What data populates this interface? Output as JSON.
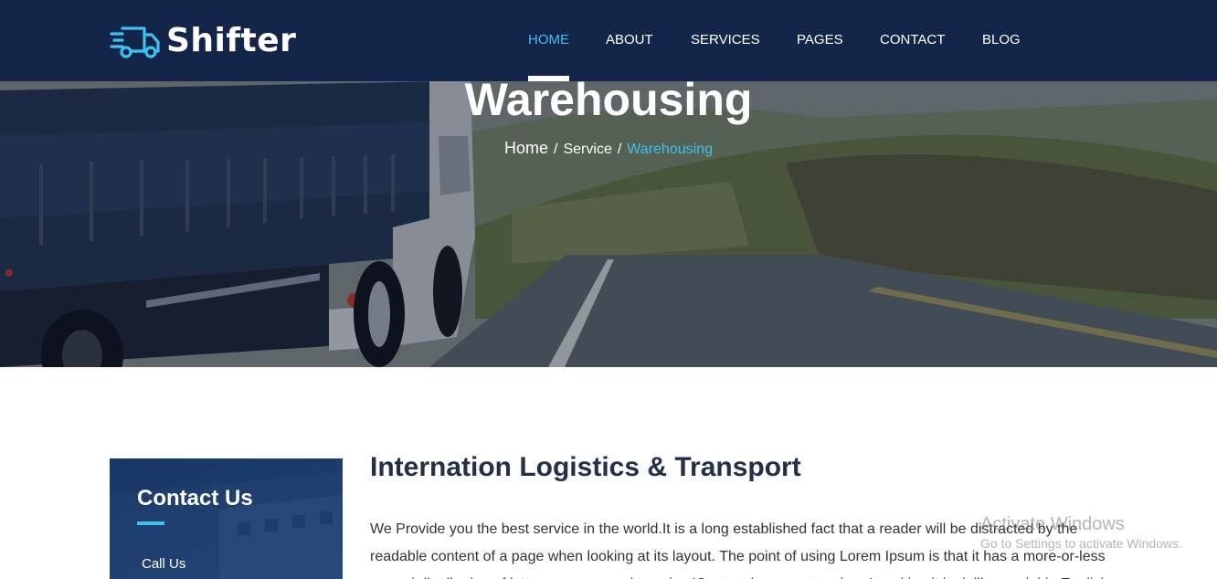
{
  "brand": {
    "name": "Shifter",
    "logo_icon": "delivery-truck-icon",
    "accent_color": "#3ec1f0",
    "header_color": "#13264a"
  },
  "nav": {
    "items": [
      {
        "label": "HOME",
        "active": true
      },
      {
        "label": "ABOUT",
        "active": false
      },
      {
        "label": "SERVICES",
        "active": false
      },
      {
        "label": "PAGES",
        "active": false
      },
      {
        "label": "CONTACT",
        "active": false
      },
      {
        "label": "BLOG",
        "active": false
      }
    ]
  },
  "hero": {
    "title": "Warehousing",
    "breadcrumb": {
      "home": "Home",
      "separator": "/",
      "parent": "Service",
      "current": "Warehousing"
    }
  },
  "sidebar": {
    "contact_title": "Contact Us",
    "call_label": "Call Us"
  },
  "article": {
    "title": "Internation Logistics & Transport",
    "body": "We Provide you the best service in the world.It is a long established fact that a reader will be distracted by the readable content of a page when looking at its layout. The point of using Lorem Ipsum is that it has a more-or-less normal distribution of letters, as opposed to using 'Content here, content here', making it look like readable English."
  },
  "watermark": {
    "title": "Activate Windows",
    "subtitle": "Go to Settings to activate Windows."
  }
}
